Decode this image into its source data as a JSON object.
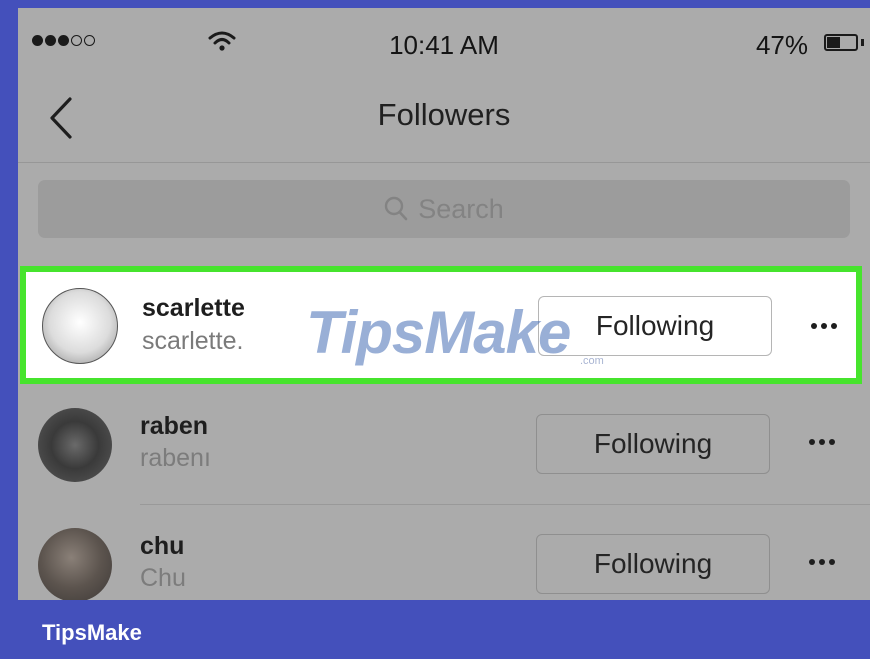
{
  "status_bar": {
    "signal": [
      true,
      true,
      true,
      false,
      false
    ],
    "time": "10:41 AM",
    "battery_percent": "47%",
    "battery_level": 0.47
  },
  "nav": {
    "title": "Followers",
    "back_icon": "chevron-left-icon"
  },
  "search": {
    "placeholder": "Search",
    "icon": "search-icon"
  },
  "followers": [
    {
      "name": "scarlette",
      "handle": "scarlette.",
      "button_label": "Following",
      "highlighted": true
    },
    {
      "name": "raben",
      "handle": "rabenı",
      "button_label": "Following",
      "highlighted": false
    },
    {
      "name": "chu",
      "handle": "Chu",
      "button_label": "Following",
      "highlighted": false
    }
  ],
  "watermark": {
    "text": "TipsMake",
    "suffix": ".com"
  },
  "footer": {
    "brand": "TipsMake"
  },
  "colors": {
    "frame": "#4450bb",
    "highlight_border": "#46e42d",
    "dim_background": "#ababab"
  }
}
